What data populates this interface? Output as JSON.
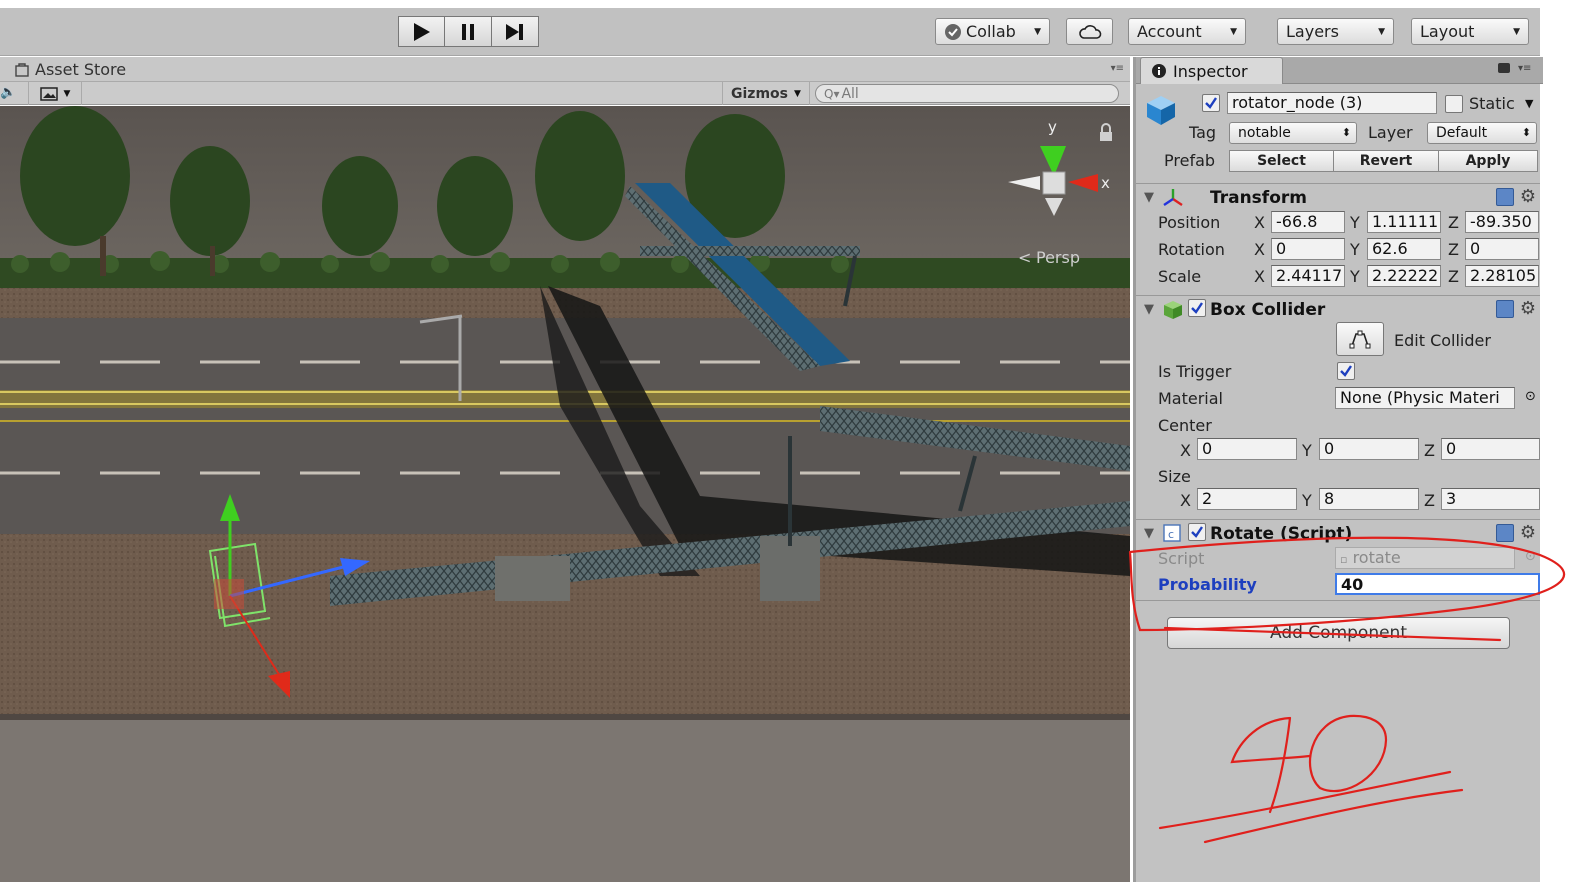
{
  "toolbar": {
    "collab_label": "Collab",
    "account_label": "Account",
    "layers_label": "Layers",
    "layout_label": "Layout",
    "icons": [
      "play-icon",
      "pause-icon",
      "step-icon",
      "cloud-icon",
      "checkmark-icon"
    ]
  },
  "scene": {
    "tab_label": "Asset Store",
    "gizmos_label": "Gizmos",
    "search_placeholder": "All",
    "axis_y": "y",
    "axis_x": "x",
    "persp_label": "Persp"
  },
  "inspector": {
    "tab_label": "Inspector",
    "object": {
      "name": "rotator_node (3)",
      "active": true,
      "static_label": "Static",
      "static": false,
      "tag_label": "Tag",
      "tag_value": "notable",
      "layer_label": "Layer",
      "layer_value": "Default",
      "prefab_label": "Prefab",
      "prefab_buttons": [
        "Select",
        "Revert",
        "Apply"
      ]
    },
    "transform": {
      "title": "Transform",
      "position_label": "Position",
      "rotation_label": "Rotation",
      "scale_label": "Scale",
      "position": {
        "x": "-66.8",
        "y": "1.11111",
        "z": "-89.350"
      },
      "rotation": {
        "x": "0",
        "y": "62.6",
        "z": "0"
      },
      "scale": {
        "x": "2.44117",
        "y": "2.22222",
        "z": "2.28105"
      }
    },
    "box_collider": {
      "title": "Box Collider",
      "enabled": true,
      "edit_label": "Edit Collider",
      "is_trigger_label": "Is Trigger",
      "is_trigger": true,
      "material_label": "Material",
      "material_value": "None (Physic Materi",
      "center_label": "Center",
      "center": {
        "x": "0",
        "y": "0",
        "z": "0"
      },
      "size_label": "Size",
      "size": {
        "x": "2",
        "y": "8",
        "z": "3"
      }
    },
    "rotate_script": {
      "title": "Rotate (Script)",
      "enabled": true,
      "script_label": "Script",
      "script_value": "rotate",
      "probability_label": "Probability",
      "probability_value": "40"
    },
    "add_component_label": "Add Component"
  },
  "annotation": {
    "handwritten_text": "40",
    "color": "#e0201c"
  },
  "colors": {
    "inspector_bg": "#c2c2c2",
    "highlight_blue": "#1d3fbf",
    "field_focus": "#3f7be8"
  }
}
